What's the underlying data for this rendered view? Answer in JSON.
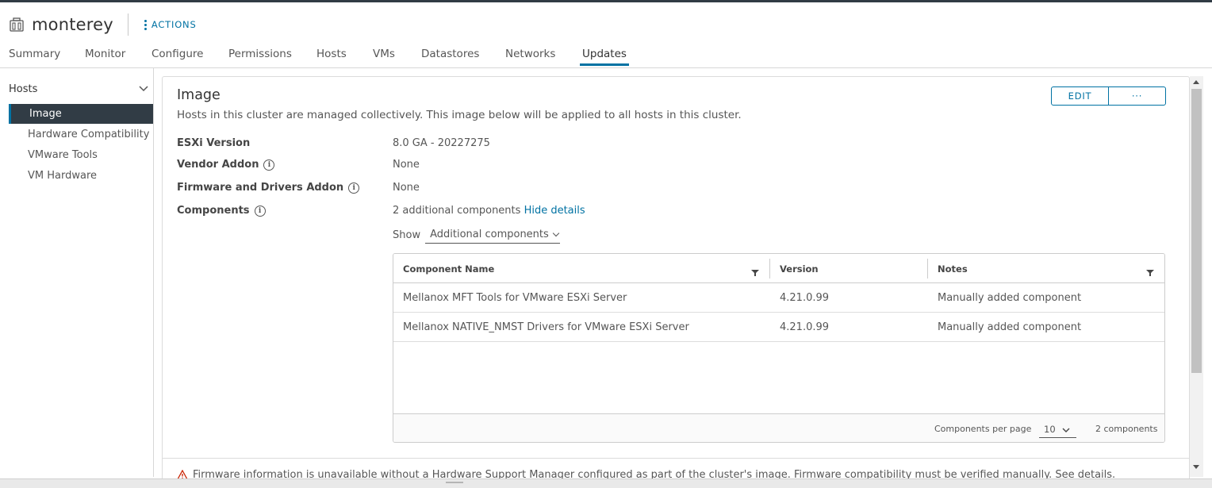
{
  "header": {
    "title": "monterey",
    "actions_label": "ACTIONS"
  },
  "tabs": [
    {
      "label": "Summary",
      "active": false
    },
    {
      "label": "Monitor",
      "active": false
    },
    {
      "label": "Configure",
      "active": false
    },
    {
      "label": "Permissions",
      "active": false
    },
    {
      "label": "Hosts",
      "active": false
    },
    {
      "label": "VMs",
      "active": false
    },
    {
      "label": "Datastores",
      "active": false
    },
    {
      "label": "Networks",
      "active": false
    },
    {
      "label": "Updates",
      "active": true
    }
  ],
  "sidebar": {
    "group_label": "Hosts",
    "items": [
      {
        "label": "Image",
        "active": true
      },
      {
        "label": "Hardware Compatibility",
        "active": false
      },
      {
        "label": "VMware Tools",
        "active": false
      },
      {
        "label": "VM Hardware",
        "active": false
      }
    ]
  },
  "image_card": {
    "title": "Image",
    "description": "Hosts in this cluster are managed collectively. This image below will be applied to all hosts in this cluster.",
    "edit_label": "EDIT",
    "more_label": "···",
    "properties": {
      "esxi_version": {
        "label": "ESXi Version",
        "value": "8.0 GA - 20227275"
      },
      "vendor_addon": {
        "label": "Vendor Addon",
        "value": "None"
      },
      "firmware_addon": {
        "label": "Firmware and Drivers Addon",
        "value": "None"
      },
      "components": {
        "label": "Components",
        "value": "2 additional components",
        "link": "Hide details"
      }
    },
    "show": {
      "label": "Show",
      "selected": "Additional components"
    },
    "grid": {
      "columns": [
        "Component Name",
        "Version",
        "Notes"
      ],
      "rows": [
        {
          "name": "Mellanox MFT Tools for VMware ESXi Server",
          "version": "4.21.0.99",
          "notes": "Manually added component"
        },
        {
          "name": "Mellanox NATIVE_NMST Drivers for VMware ESXi Server",
          "version": "4.21.0.99",
          "notes": "Manually added component"
        }
      ],
      "footer": {
        "per_page_label": "Components per page",
        "per_page_value": "10",
        "count_label": "2 components"
      }
    },
    "warning_text": "Firmware information is unavailable without a Hardware Support Manager configured as part of the cluster's image. Firmware compatibility must be verified manually. See details."
  },
  "colors": {
    "accent": "#0072a3",
    "nav_active_bg": "#313c45"
  },
  "icons": {
    "cluster": "cluster-icon",
    "info": "info-icon",
    "filter": "filter-icon",
    "warning": "warning-icon",
    "chevron": "chevron-down-icon"
  }
}
